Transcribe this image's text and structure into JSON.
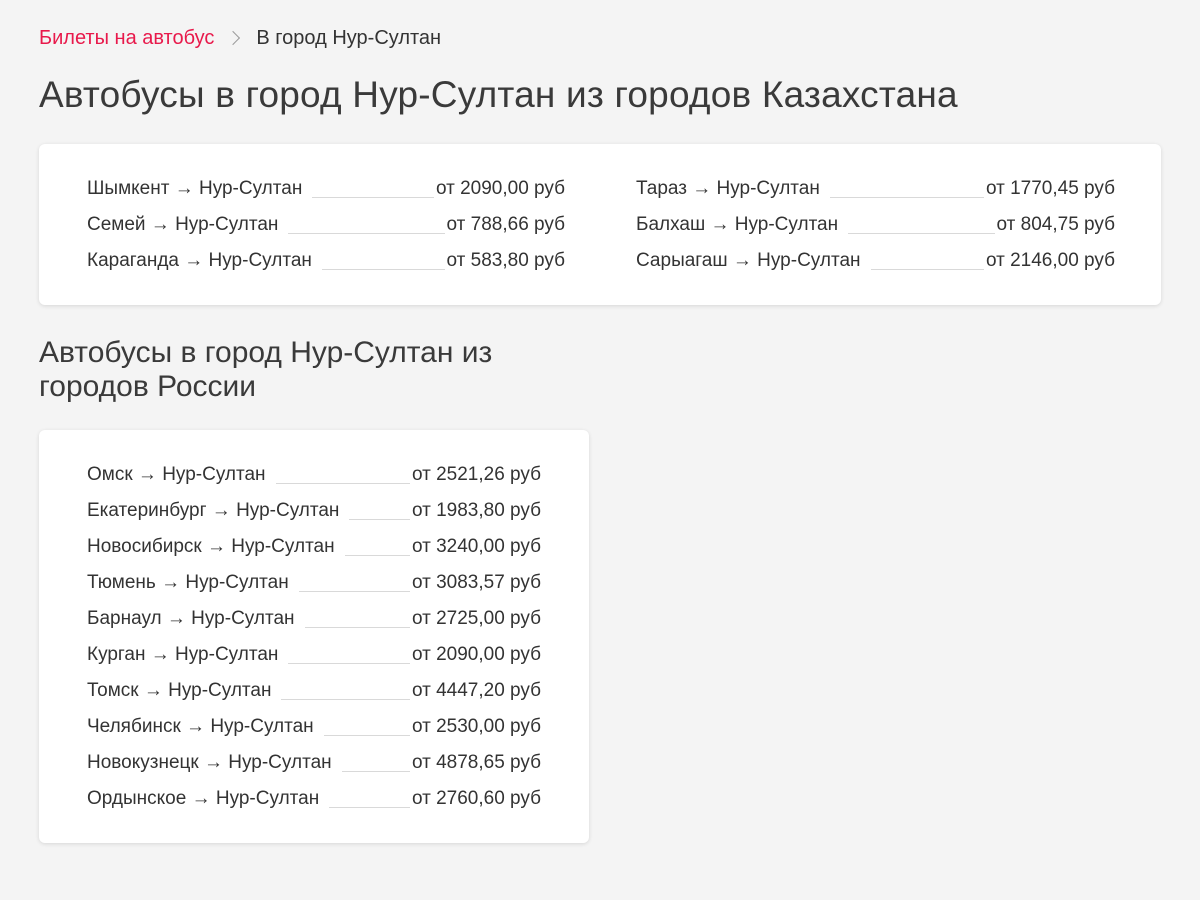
{
  "breadcrumb": {
    "home_label": "Билеты на автобус",
    "current_label": "В город Нур-Султан"
  },
  "page_title": "Автобусы в город Нур-Султан из городов Казахстана",
  "kazakhstan": {
    "left": [
      {
        "route": "Шымкент → Нур-Султан",
        "price": "от 2090,00 руб"
      },
      {
        "route": "Семей → Нур-Султан",
        "price": "от 788,66 руб"
      },
      {
        "route": "Караганда → Нур-Султан",
        "price": "от 583,80 руб"
      }
    ],
    "right": [
      {
        "route": "Тараз → Нур-Султан",
        "price": "от 1770,45 руб"
      },
      {
        "route": "Балхаш → Нур-Султан",
        "price": "от 804,75 руб"
      },
      {
        "route": "Сарыагаш → Нур-Султан",
        "price": "от 2146,00 руб"
      }
    ]
  },
  "russia": {
    "title": "Автобусы в город Нур-Султан из городов России",
    "routes": [
      {
        "route": "Омск → Нур-Султан",
        "price": "от 2521,26 руб"
      },
      {
        "route": "Екатеринбург → Нур-Султан",
        "price": "от 1983,80 руб"
      },
      {
        "route": "Новосибирск → Нур-Султан",
        "price": "от 3240,00 руб"
      },
      {
        "route": "Тюмень → Нур-Султан",
        "price": "от 3083,57 руб"
      },
      {
        "route": "Барнаул → Нур-Султан",
        "price": "от 2725,00 руб"
      },
      {
        "route": "Курган → Нур-Султан",
        "price": "от 2090,00 руб"
      },
      {
        "route": "Томск → Нур-Султан",
        "price": "от 4447,20 руб"
      },
      {
        "route": "Челябинск → Нур-Султан",
        "price": "от 2530,00 руб"
      },
      {
        "route": "Новокузнецк → Нур-Султан",
        "price": "от 4878,65 руб"
      },
      {
        "route": "Ордынское → Нур-Султан",
        "price": "от 2760,60 руб"
      }
    ]
  },
  "colors": {
    "accent": "#e8194b",
    "background": "#f4f4f4",
    "card": "#ffffff",
    "text": "#333333"
  },
  "icons": {
    "breadcrumb_separator": "chevron-right-icon"
  }
}
